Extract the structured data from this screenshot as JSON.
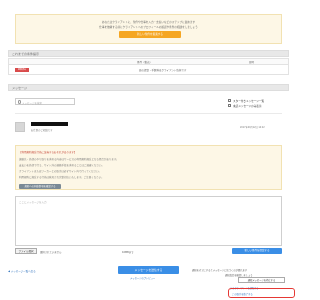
{
  "top_notice": {
    "line1": "あなたはクライアントに、条件や仕事を入力・支払いなどのステップに進めます",
    "line2": "仕事を依頼する前にクライアントへのプロフィールの確認や条件の相談をしましょう",
    "button_label": "新しい条件を提案する"
  },
  "offers_section": {
    "title": "これまでの条件提示",
    "columns": [
      "条件（税込）",
      "日時"
    ],
    "row": {
      "badge": "提案済み",
      "text": "仮の提案・手数料はクライアント負担です"
    }
  },
  "messages_section": {
    "title": "メッセージ",
    "search_placeholder": "メッセージを検索",
    "checkbox1_label": "スター付きメッセージ一覧",
    "checkbox2_label": "未読メッセージのみ表示"
  },
  "message": {
    "sender_sub": "お仕事のご相談です",
    "date": "2017年09月12日 14:22"
  },
  "notice_box": {
    "lines": [
      "【利用規約違反行為に該当するおそれがあります】",
      "連絡先・外部のやり取りを求める内容はサービスの利用規約違反となる場合があります。",
      "支払いを外部で行う、サイト外の連絡手段を求めることはご遠慮ください。",
      "クライアントまたはワーカーとの取引は必ずサイト内で行ってください。",
      "利用規約に違反する行為は発見され次第対応いたします。ご注意ください。"
    ],
    "button_label": "規約への同意事項を確認する"
  },
  "reply": {
    "placeholder": "ここにメッセージを入力",
    "file_button": "ファイル選択",
    "file_text": "選択されていません",
    "file_size": "10MBまで",
    "right_button": "新しい条件を提案する"
  },
  "footer": {
    "back_link": "◀ メッセージ一覧へ戻る",
    "send_button": "メッセージを送信する",
    "send_sub": "メッセージのプレビュー",
    "note1": "通知をオフにするとメッセージに気づくのが遅れます",
    "note2": "通知設定を確認しましょう",
    "outline_button": "通知メッセージを停止する",
    "faint_link": "このクライアントを通報する",
    "red_box_link": "この取引を終了する"
  }
}
